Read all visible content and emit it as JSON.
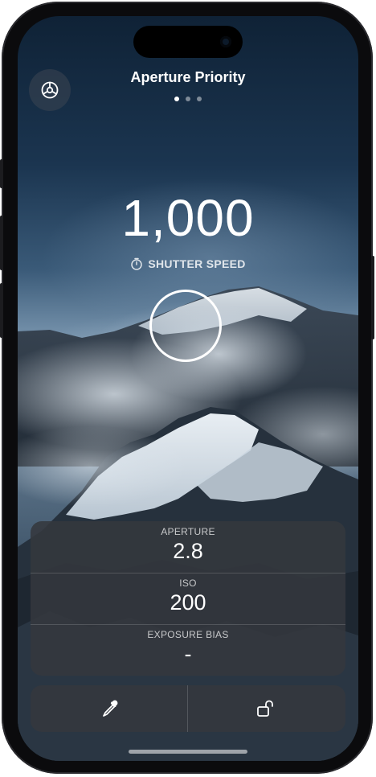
{
  "header": {
    "title": "Aperture Priority",
    "page_dots": 3,
    "active_dot": 0
  },
  "readout": {
    "value": "1,000",
    "label": "SHUTTER SPEED",
    "label_icon": "timer-icon"
  },
  "settings": [
    {
      "label": "APERTURE",
      "value": "2.8"
    },
    {
      "label": "ISO",
      "value": "200"
    },
    {
      "label": "EXPOSURE BIAS",
      "value": "-"
    }
  ],
  "toolbar": {
    "left_icon": "eyedropper-icon",
    "right_icon": "unlock-icon"
  },
  "icons": {
    "settings": "gear-icon"
  },
  "colors": {
    "text": "#ffffff",
    "panel": "#34383e"
  }
}
